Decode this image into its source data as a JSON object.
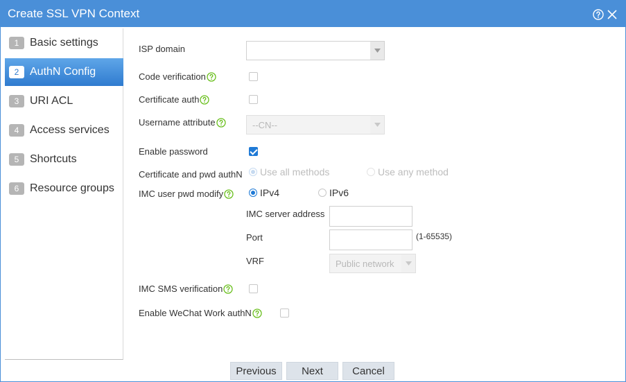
{
  "window": {
    "title": "Create SSL VPN Context",
    "help_icon": "help-circle-icon",
    "close_icon": "close-icon",
    "accent_color": "#4a8fd8"
  },
  "sidebar": {
    "active_index": 1,
    "items": [
      {
        "num": "1",
        "label": "Basic settings"
      },
      {
        "num": "2",
        "label": "AuthN Config"
      },
      {
        "num": "3",
        "label": "URI ACL"
      },
      {
        "num": "4",
        "label": "Access services"
      },
      {
        "num": "5",
        "label": "Shortcuts"
      },
      {
        "num": "6",
        "label": "Resource groups"
      }
    ]
  },
  "form": {
    "isp_domain": {
      "label": "ISP domain",
      "value": ""
    },
    "code_verification": {
      "label": "Code verification",
      "checked": false
    },
    "certificate_auth": {
      "label": "Certificate auth",
      "checked": false
    },
    "username_attribute": {
      "label": "Username attribute",
      "value": "--CN--"
    },
    "enable_password": {
      "label": "Enable password",
      "checked": true
    },
    "cert_pwd_authn": {
      "label": "Certificate and pwd authN",
      "option_all": "Use all methods",
      "option_any": "Use any method",
      "selected": "all"
    },
    "imc_user_pwd_modify": {
      "label": "IMC user pwd modify",
      "option_ipv4": "IPv4",
      "option_ipv6": "IPv6",
      "selected": "ipv4"
    },
    "imc_server_address": {
      "label": "IMC server address",
      "value": ""
    },
    "port": {
      "label": "Port",
      "value": "",
      "hint": "(1-65535)"
    },
    "vrf": {
      "label": "VRF",
      "value": "Public network"
    },
    "imc_sms_verification": {
      "label": "IMC SMS verification",
      "checked": false
    },
    "wechat_work_authn": {
      "label": "Enable WeChat Work authN",
      "checked": false
    }
  },
  "buttons": {
    "previous": "Previous",
    "next": "Next",
    "cancel": "Cancel"
  }
}
